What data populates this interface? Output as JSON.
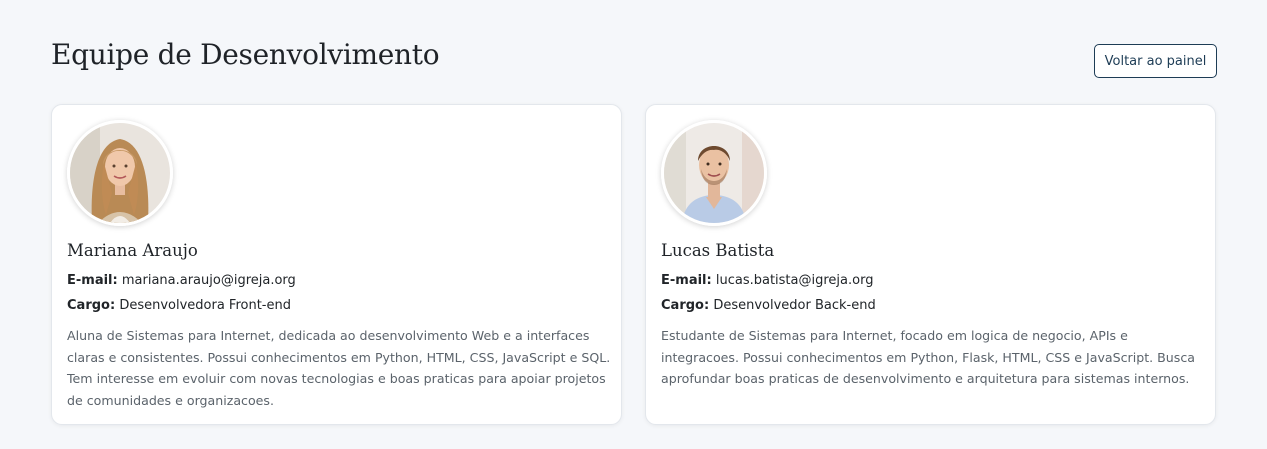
{
  "header": {
    "title": "Equipe de Desenvolvimento",
    "back_label": "Voltar ao painel"
  },
  "team": [
    {
      "name": "Mariana Araujo",
      "email_label": "E-mail:",
      "email": "mariana.araujo@igreja.org",
      "role_label": "Cargo:",
      "role": "Desenvolvedora Front-end",
      "description": "Aluna de Sistemas para Internet, dedicada ao desenvolvimento Web e a interfaces claras e consistentes. Possui conhecimentos em Python, HTML, CSS, JavaScript e SQL. Tem interesse em evoluir com novas tecnologias e boas praticas para apoiar projetos de comunidades e organizacoes.",
      "avatar_icon": "avatar-photo-woman"
    },
    {
      "name": "Lucas Batista",
      "email_label": "E-mail:",
      "email": "lucas.batista@igreja.org",
      "role_label": "Cargo:",
      "role": "Desenvolvedor Back-end",
      "description": "Estudante de Sistemas para Internet, focado em logica de negocio, APIs e integracoes. Possui conhecimentos em Python, Flask, HTML, CSS e JavaScript. Busca aprofundar boas praticas de desenvolvimento e arquitetura para sistemas internos.",
      "avatar_icon": "avatar-photo-man"
    }
  ],
  "colors": {
    "background": "#f5f7fa",
    "accent": "#1d3c55",
    "card_border": "#e3e7ec",
    "description_text": "#5b636b"
  }
}
